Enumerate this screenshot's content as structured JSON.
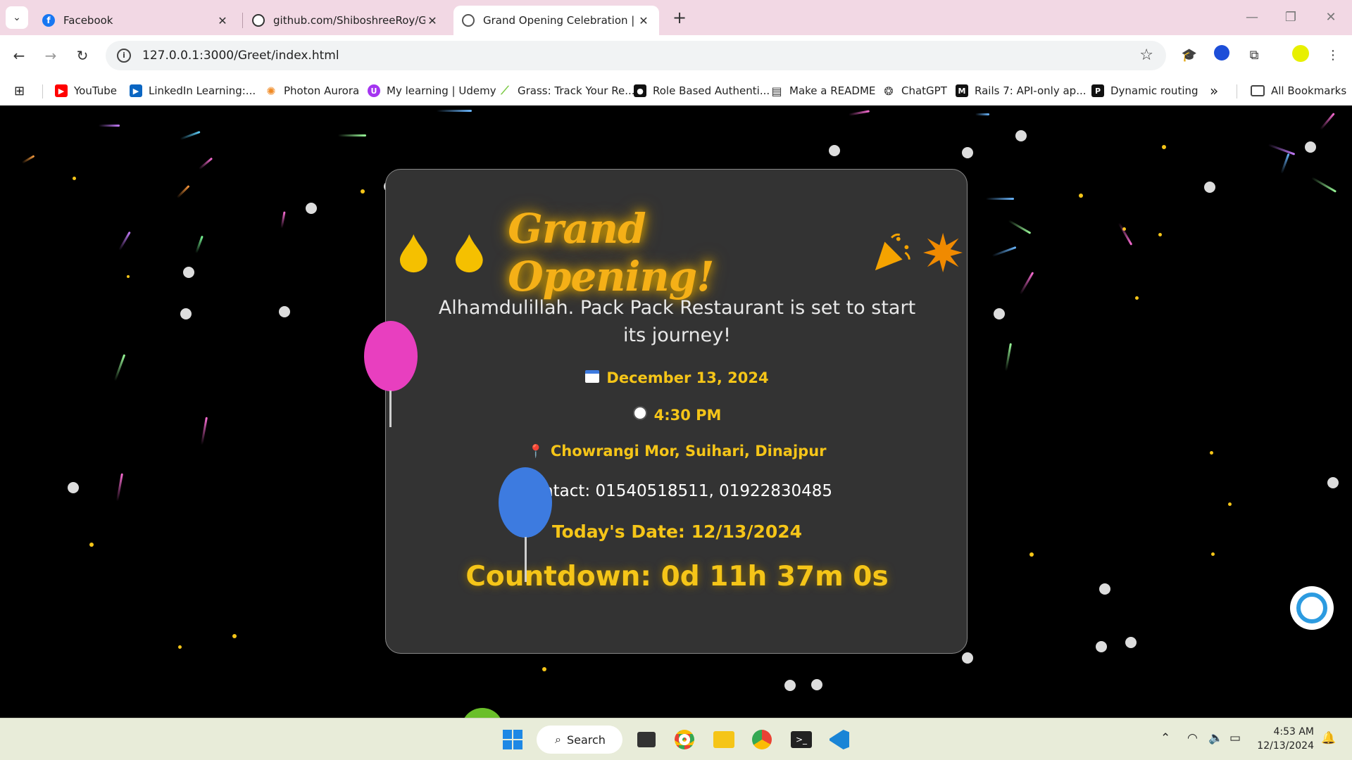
{
  "browser": {
    "tabs": [
      {
        "title": "Facebook",
        "icon": "facebook-icon",
        "active": false
      },
      {
        "title": "github.com/ShiboshreeRoy/Gra",
        "icon": "github-icon",
        "active": false
      },
      {
        "title": "Grand Opening Celebration | Pa",
        "icon": "globe-icon",
        "active": true
      }
    ],
    "close_glyph": "✕",
    "new_tab_glyph": "+",
    "url": "127.0.0.1:3000/Greet/index.html",
    "bookmarks": [
      {
        "label": "YouTube",
        "icon": "youtube-icon",
        "color": "#ff0000"
      },
      {
        "label": "LinkedIn Learning:...",
        "icon": "linkedin-learning-icon",
        "color": "#0a66c2"
      },
      {
        "label": "Photon Aurora",
        "icon": "photon-icon",
        "color": "#f08a24"
      },
      {
        "label": "My learning | Udemy",
        "icon": "udemy-icon",
        "color": "#a435f0"
      },
      {
        "label": "Grass: Track Your Re...",
        "icon": "grass-icon",
        "color": "#7ac943"
      },
      {
        "label": "Role Based Authenti...",
        "icon": "medium-icon",
        "color": "#111111"
      },
      {
        "label": "Make a README",
        "icon": "document-icon",
        "color": "#333333"
      },
      {
        "label": "ChatGPT",
        "icon": "chatgpt-icon",
        "color": "#444444"
      },
      {
        "label": "Rails 7: API-only ap...",
        "icon": "medium-icon",
        "color": "#111111"
      },
      {
        "label": "Dynamic routing",
        "icon": "p-icon",
        "color": "#111111"
      }
    ],
    "more_bookmarks_glyph": "»",
    "all_bookmarks_label": "All Bookmarks"
  },
  "page": {
    "title": "Grand Opening!",
    "subtitle": "Alhamdulillah. Pack Pack Restaurant is set to start its journey!",
    "date": "December 13, 2024",
    "time": "4:30 PM",
    "location": "Chowrangi Mor, Suihari, Dinajpur",
    "contact": "Contact: 01540518511, 01922830485",
    "today": "Today's Date: 12/13/2024",
    "countdown": "Countdown: 0d 11h 37m 0s",
    "colors": {
      "accent": "#f5c518",
      "card": "#333333",
      "background": "#000000"
    }
  },
  "taskbar": {
    "search_label": "Search",
    "time": "4:53 AM",
    "date": "12/13/2024"
  }
}
